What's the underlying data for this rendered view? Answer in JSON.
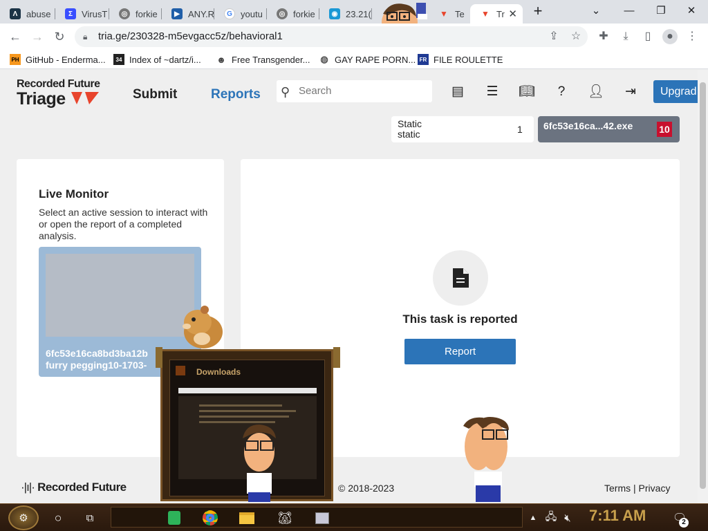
{
  "browser": {
    "tabs": [
      {
        "title": "abuse",
        "icon": "abuse-logo-icon",
        "color": "#1a73e8"
      },
      {
        "title": "VirusT",
        "icon": "virustotal-icon",
        "color": "#394eff"
      },
      {
        "title": "forkie",
        "icon": "globe-icon",
        "color": "#5f6368"
      },
      {
        "title": "ANY.R",
        "icon": "anyrun-icon",
        "color": "#1f5ea8"
      },
      {
        "title": "youtu",
        "icon": "google-icon",
        "color": "#4285f4"
      },
      {
        "title": "forkie",
        "icon": "globe-icon",
        "color": "#5f6368"
      },
      {
        "title": "23.21(",
        "icon": "location-pin-icon",
        "color": "#1a98d5"
      },
      {
        "title": "Te",
        "icon": "triage-icon",
        "color": "#e8442c"
      },
      {
        "title": "Tr",
        "icon": "triage-icon",
        "color": "#e8442c"
      }
    ],
    "new_tab_label": "+",
    "url": "tria.ge/230328-m5evgacc5z/behavioral1",
    "bookmarks": [
      {
        "label": "GitHub - Enderma...",
        "icon": "pornhub-icon"
      },
      {
        "label": "Index of ~dartz/i...",
        "icon": "index-icon"
      },
      {
        "label": "Free Transgender...",
        "icon": "mask-icon"
      },
      {
        "label": "GAY RAPE PORN...",
        "icon": "globe-icon"
      },
      {
        "label": "FILE ROULETTE",
        "icon": "file-roulette-icon"
      }
    ]
  },
  "header": {
    "brand_small": "Recorded Future",
    "brand_big": "Triage",
    "nav_submit": "Submit",
    "nav_reports": "Reports",
    "search_placeholder": "Search",
    "upgrade_label": "Upgrad"
  },
  "tasks": {
    "static_label_1": "Static",
    "static_label_2": "static",
    "static_count": "1",
    "sample_name": "6fc53e16ca...42.exe",
    "sample_score": "10"
  },
  "live_monitor": {
    "title": "Live Monitor",
    "description": "Select an active session to interact with or open the report of a completed analysis.",
    "session_line1": "6fc53e16ca8bd3ba12b",
    "session_line2": "furry pegging10-1703-"
  },
  "main": {
    "status_text": "This task is reported",
    "report_button": "Report"
  },
  "footer": {
    "logo": "Recorded Future",
    "copyright": "© 2018-2023",
    "terms": "Terms",
    "separator": "|",
    "privacy": "Privacy"
  },
  "overlay": {
    "downloads_title": "Downloads"
  },
  "taskbar": {
    "clock": "7:11 AM",
    "notifications_count": "2"
  },
  "colors": {
    "accent_blue": "#2c74b8",
    "brand_red": "#e8442c",
    "score_red": "#c8102e"
  }
}
